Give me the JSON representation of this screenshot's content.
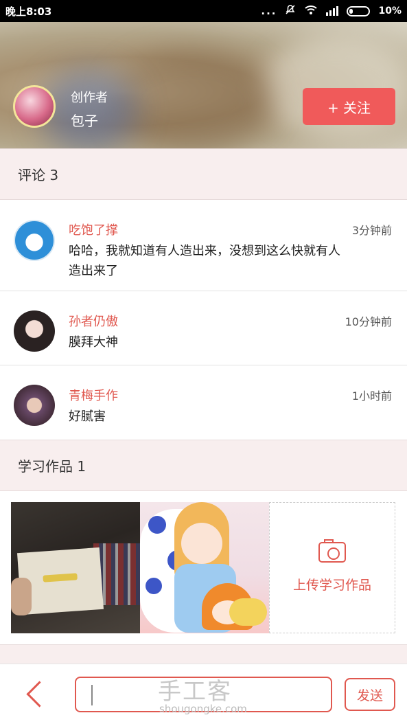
{
  "status_bar": {
    "time": "晚上8:03",
    "signal_dots": "...",
    "battery": "10%"
  },
  "header": {
    "author_role": "创作者",
    "author_name": "包子",
    "follow_label": "+ 关注"
  },
  "comments_section": {
    "title": "评论 3",
    "items": [
      {
        "name": "吃饱了撑",
        "time": "3分钟前",
        "text": "哈哈，我就知道有人造出来，没想到这么快就有人造出来了"
      },
      {
        "name": "孙者仍傲",
        "time": "10分钟前",
        "text": "膜拜大神"
      },
      {
        "name": "青梅手作",
        "time": "1小时前",
        "text": "好腻害"
      }
    ]
  },
  "works_section": {
    "title": "学习作品 1",
    "upload_label": "上传学习作品"
  },
  "bottom_bar": {
    "watermark": "手工客",
    "watermark_sub": "shougongke.com",
    "send_label": "发送"
  },
  "colors": {
    "accent": "#f05a5a",
    "section_bg": "#f8eeee"
  }
}
